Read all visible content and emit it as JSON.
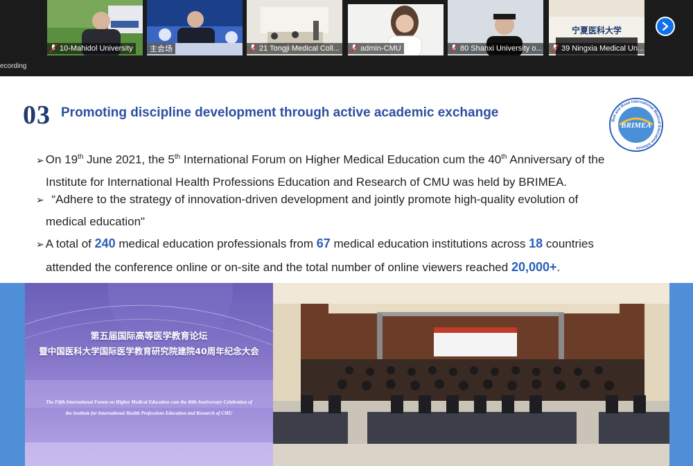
{
  "participants": [
    {
      "name": "10-Mahidol University"
    },
    {
      "name": "主会场"
    },
    {
      "name": "21 Tongji Medical Coll..."
    },
    {
      "name": "admin-CMU"
    },
    {
      "name": "80 Shanxi University o..."
    },
    {
      "name": "39 Ningxia Medical Un..."
    }
  ],
  "recording_label": "ecording",
  "slide": {
    "number": "03",
    "title": "Promoting discipline development through active academic exchange",
    "logo_text": "BRIMEA",
    "logo_ring_text": "Belt and Road International Medical Education Alliance",
    "para1_a": "On 19",
    "para1_sup1": "th",
    "para1_b": " June 2021, the 5",
    "para1_sup2": "th",
    "para1_c": " International Forum on Higher Medical Education cum the 40",
    "para1_sup3": "th",
    "para1_d": " Anniversary of the",
    "para1_line2": "Institute for International Health Professions Education and Research of CMU was held by BRIMEA.",
    "para2_line1": " “Adhere to the strategy of innovation-driven development and jointly promote high-quality evolution of",
    "para2_line2": "medical education\"",
    "para3_a": "A total of ",
    "para3_n1": "240",
    "para3_b": " medical education professionals from ",
    "para3_n2": "67",
    "para3_c": " medical education institutions across ",
    "para3_n3": "18",
    "para3_d": " countries",
    "para3_line2a": "attended the conference online or on-site and the total number of online viewers reached ",
    "para3_n4": "20,000+",
    "para3_line2b": ".",
    "poster_cn1": "第五届国际高等医学教育论坛",
    "poster_cn2": "暨中国医科大学国际医学教育研究院建院40周年纪念大会",
    "poster_en1": "The Fifth International Forum on Higher Medical Education cum the 40th Anniversary Celebration of",
    "poster_en2": "the Institute for International Health Professions Education and Research of CMU",
    "ningxia_sign": "宁夏医科大学"
  },
  "colors": {
    "accent": "#2b5fb8",
    "number": "#1f3a6e",
    "zoom_blue": "#0e71eb",
    "mic_red": "#e02828"
  }
}
